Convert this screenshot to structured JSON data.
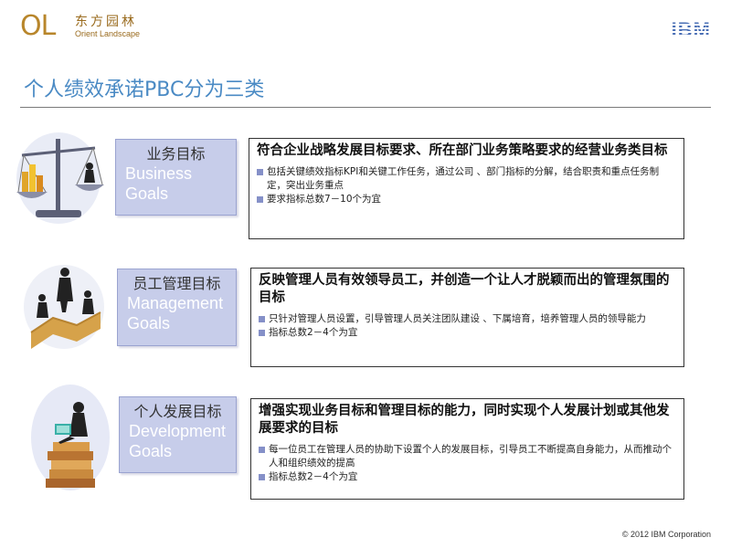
{
  "header": {
    "logo_mark": "OL",
    "logo_cn": "东方园林",
    "logo_en": "Orient Landscape",
    "ibm": "IBM"
  },
  "title": "个人绩效承诺PBC分为三类",
  "sections": [
    {
      "label_cn": "业务目标",
      "label_en": "Business Goals",
      "heading": "符合企业战略发展目标要求、所在部门业务策略要求的经营业务类目标",
      "bullets": [
        "包括关键绩效指标KPI和关键工作任务，通过公司 、部门指标的分解，结合职责和重点任务制定，突出业务重点",
        "要求指标总数7－10个为宜"
      ]
    },
    {
      "label_cn": "员工管理目标",
      "label_en": "Management Goals",
      "heading": "反映管理人员有效领导员工，并创造一个让人才脱颖而出的管理氛围的目标",
      "bullets": [
        "只针对管理人员设置，引导管理人员关注团队建设 、下属培育，培养管理人员的领导能力",
        "指标总数2－4个为宜"
      ]
    },
    {
      "label_cn": "个人发展目标",
      "label_en": "Development Goals",
      "heading": "增强实现业务目标和管理目标的能力，同时实现个人发展计划或其他发展要求的目标",
      "bullets": [
        "每一位员工在管理人员的协助下设置个人的发展目标，引导员工不断提高自身能力，从而推动个人和组织绩效的提高",
        "指标总数2－4个为宜"
      ]
    }
  ],
  "footer": "© 2012 IBM Corporation",
  "colors": {
    "title": "#4a8ac4",
    "label_bg": "#c7cdea",
    "bullet": "#8590c8",
    "logo": "#b8862b",
    "ibm": "#4a6fb5"
  }
}
